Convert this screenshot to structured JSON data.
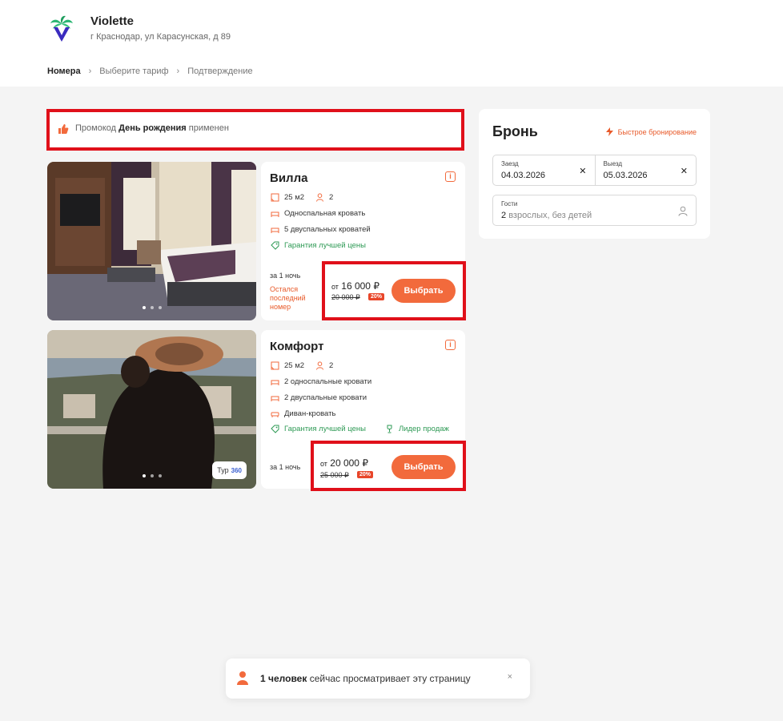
{
  "hotel": {
    "name": "Violette",
    "address": "г Краснодар, ул Карасунская, д 89"
  },
  "breadcrumb": [
    "Номера",
    "Выберите тариф",
    "Подтверждение"
  ],
  "promo": {
    "prefix": "Промокод",
    "code": "День рождения",
    "suffix": "применен"
  },
  "rooms": [
    {
      "title": "Вилла",
      "area": "25 м2",
      "guests": "2",
      "beds": [
        "Односпальная кровать",
        "5 двуспальных кроватей"
      ],
      "badges": [
        "Гарантия лучшей цены"
      ],
      "per_night": "за 1 ночь",
      "note": [
        "Остался",
        "последний",
        "номер"
      ],
      "price_prefix": "от",
      "price": "16 000 ₽",
      "old_price": "20 000 ₽",
      "discount": "20%",
      "button": "Выбрать",
      "photo_dots": 3
    },
    {
      "title": "Комфорт",
      "area": "25 м2",
      "guests": "2",
      "beds": [
        "2 односпальные кровати",
        "2 двуспальные кровати",
        "Диван-кровать"
      ],
      "badges": [
        "Гарантия лучшей цены",
        "Лидер продаж"
      ],
      "per_night": "за 1 ночь",
      "price_prefix": "от",
      "price": "20 000 ₽",
      "old_price": "25 000 ₽",
      "discount": "20%",
      "button": "Выбрать",
      "tour": "Тур",
      "tour_icon": "360",
      "photo_dots": 3
    }
  ],
  "booking": {
    "title": "Бронь",
    "quick": "Быстрое бронирование",
    "checkin_label": "Заезд",
    "checkin": "04.03.2026",
    "checkout_label": "Выезд",
    "checkout": "05.03.2026",
    "guests_label": "Гости",
    "guests_count": "2",
    "guests_text": "взрослых, без детей"
  },
  "toast": {
    "bold": "1 человек",
    "text": "сейчас просматривает эту страницу",
    "close": "×"
  },
  "colors": {
    "accent": "#f26a3c",
    "highlight": "#e0101a",
    "green": "#2e9a55"
  }
}
